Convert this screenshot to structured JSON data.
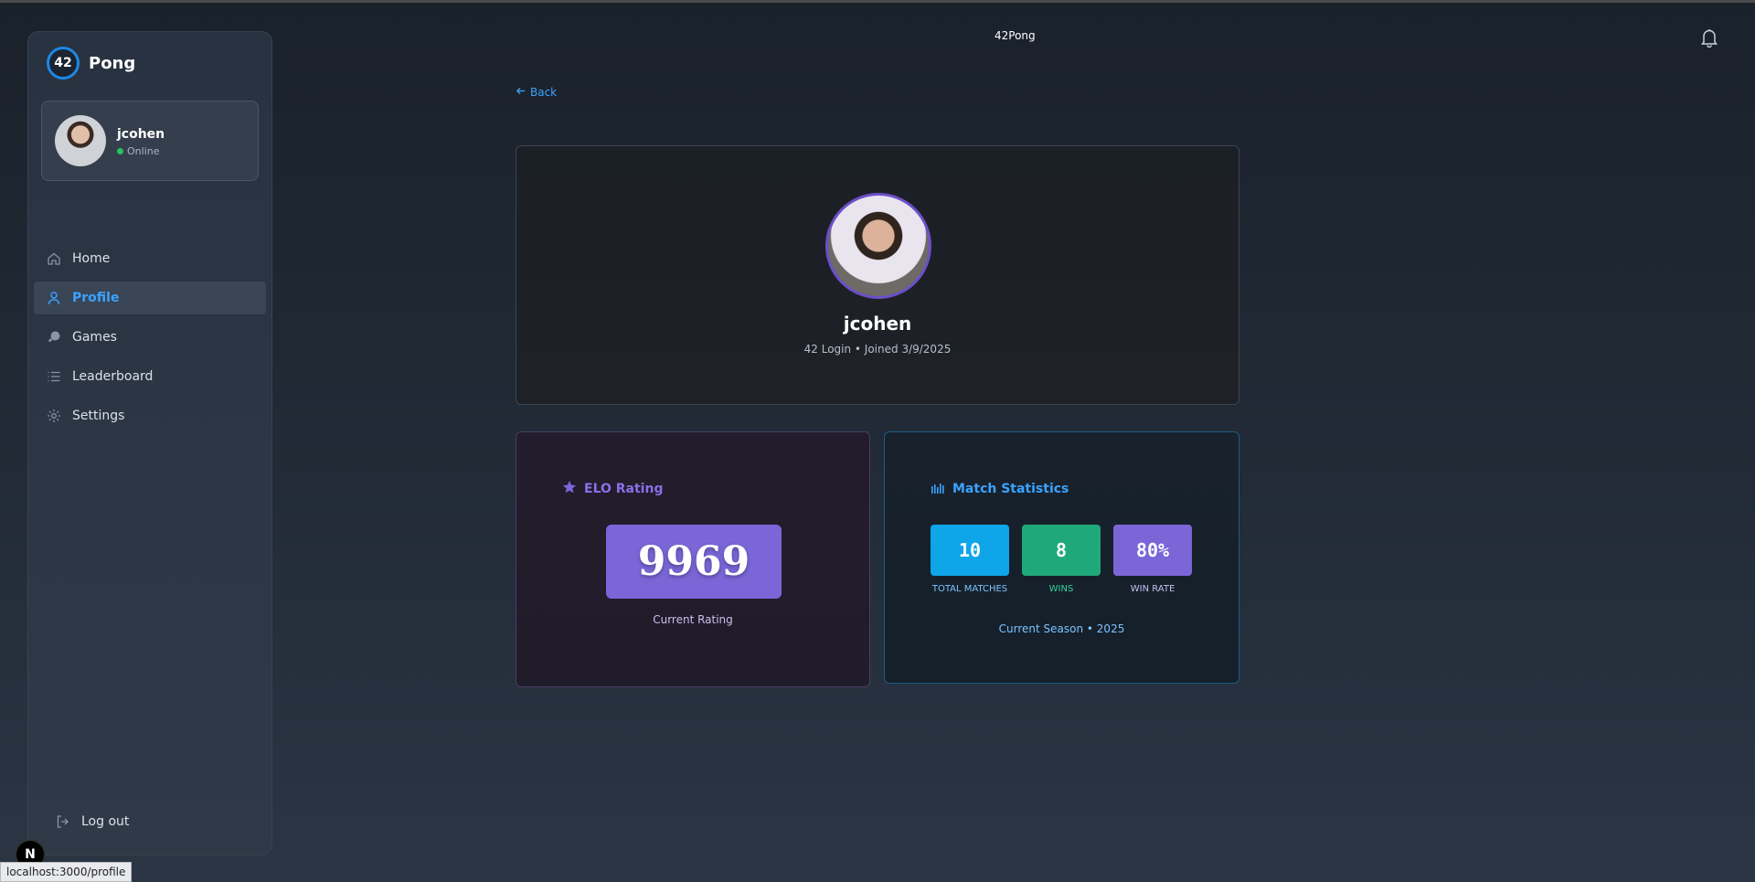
{
  "app_title": "42Pong",
  "sidebar": {
    "brand_logo": "42",
    "brand_name": "Pong",
    "user": {
      "name": "jcohen",
      "status": "Online",
      "status_color": "#22c55e"
    },
    "items": [
      {
        "label": "Home",
        "icon": "home-icon",
        "active": false
      },
      {
        "label": "Profile",
        "icon": "user-icon",
        "active": true
      },
      {
        "label": "Games",
        "icon": "paddle-icon",
        "active": false
      },
      {
        "label": "Leaderboard",
        "icon": "list-icon",
        "active": false
      },
      {
        "label": "Settings",
        "icon": "gear-icon",
        "active": false
      }
    ],
    "logout_label": "Log out"
  },
  "back_label": "Back",
  "profile": {
    "name": "jcohen",
    "meta": "42 Login • Joined 3/9/2025"
  },
  "elo": {
    "title": "ELO Rating",
    "value": "9969",
    "caption": "Current Rating",
    "accent": "#7b66d8"
  },
  "match_stats": {
    "title": "Match Statistics",
    "stats": [
      {
        "value": "10",
        "label": "TOTAL MATCHES",
        "color": "#0ea5e9",
        "label_color": "#7cc3ff"
      },
      {
        "value": "8",
        "label": "WINS",
        "color": "#1fa97a",
        "label_color": "#34d399"
      },
      {
        "value": "80%",
        "label": "WIN RATE",
        "color": "#7b66d8",
        "label_color": "#c8bff0"
      }
    ],
    "season": "Current Season • 2025"
  },
  "nextjs_badge": "N",
  "url_status": "localhost:3000/profile"
}
